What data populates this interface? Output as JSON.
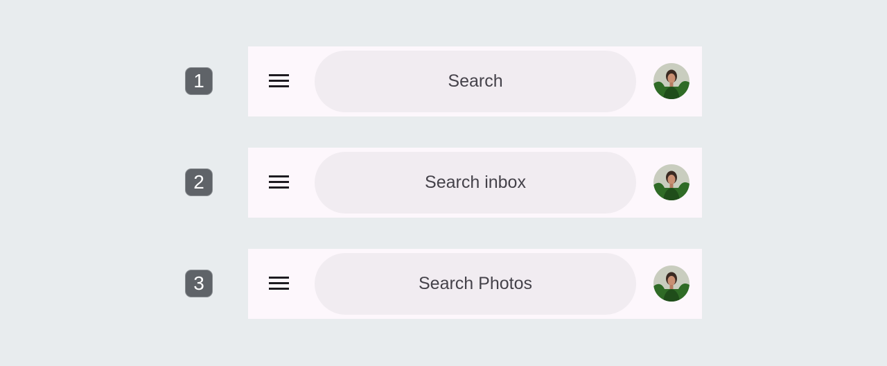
{
  "variants": [
    {
      "number": "1",
      "search_placeholder": "Search",
      "avatar_icon": "profile-avatar"
    },
    {
      "number": "2",
      "search_placeholder": "Search inbox",
      "avatar_icon": "profile-avatar"
    },
    {
      "number": "3",
      "search_placeholder": "Search Photos",
      "avatar_icon": "profile-avatar"
    }
  ],
  "icons": {
    "menu": "hamburger-menu-icon"
  },
  "colors": {
    "background": "#e8ecee",
    "bar_background": "#fdf7fc",
    "search_field": "#f1ecf1",
    "badge": "#5f6368",
    "text": "#45424a"
  }
}
